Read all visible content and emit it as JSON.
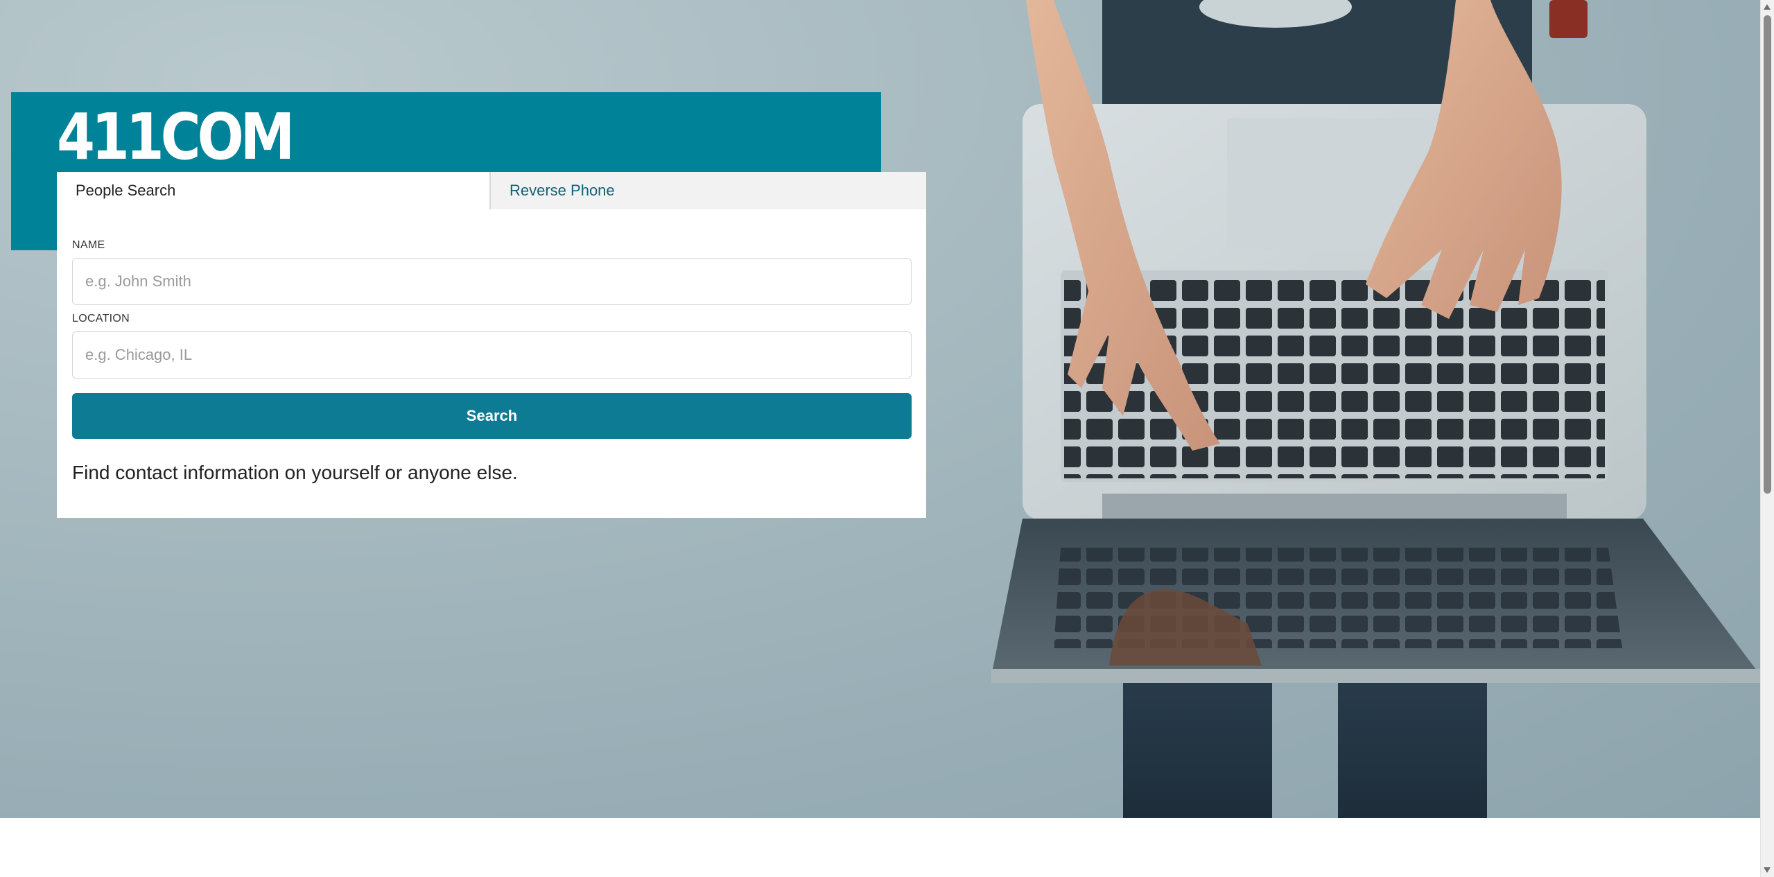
{
  "brand": {
    "logo_text": "411COM",
    "accent_color": "#008299"
  },
  "tabs": [
    {
      "label": "People Search",
      "active": true
    },
    {
      "label": "Reverse Phone",
      "active": false
    }
  ],
  "form": {
    "name": {
      "label": "NAME",
      "placeholder": "e.g. John Smith",
      "value": ""
    },
    "location": {
      "label": "LOCATION",
      "placeholder": "e.g. Chicago, IL",
      "value": ""
    },
    "submit_label": "Search",
    "button_color": "#0d7b93"
  },
  "tagline": "Find contact information on yourself or anyone else.",
  "hero_image": "person-typing-on-laptop-photo"
}
